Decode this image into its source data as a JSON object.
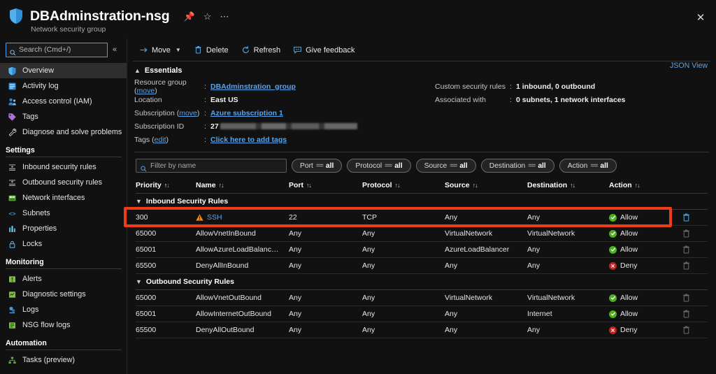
{
  "header": {
    "title": "DBAdminstration-nsg",
    "subtitle": "Network security group",
    "pin_icon": "pin-icon",
    "favorite_icon": "star-icon",
    "more_icon": "ellipsis-icon",
    "close_icon": "close-icon"
  },
  "sidebar": {
    "search": {
      "placeholder": "Search (Cmd+/)",
      "value": "",
      "icon": "search-icon"
    },
    "collapse_icon": "chevron-double-left-icon",
    "items": [
      {
        "label": "Overview",
        "icon": "shield-icon",
        "active": true
      },
      {
        "label": "Activity log",
        "icon": "activity-log-icon",
        "active": false
      },
      {
        "label": "Access control (IAM)",
        "icon": "access-control-icon",
        "active": false
      },
      {
        "label": "Tags",
        "icon": "tag-icon",
        "active": false
      },
      {
        "label": "Diagnose and solve problems",
        "icon": "wrench-icon",
        "active": false
      }
    ],
    "sections": [
      {
        "title": "Settings",
        "items": [
          {
            "label": "Inbound security rules",
            "icon": "inbound-rules-icon"
          },
          {
            "label": "Outbound security rules",
            "icon": "outbound-rules-icon"
          },
          {
            "label": "Network interfaces",
            "icon": "network-interface-icon"
          },
          {
            "label": "Subnets",
            "icon": "subnet-icon"
          },
          {
            "label": "Properties",
            "icon": "properties-icon"
          },
          {
            "label": "Locks",
            "icon": "lock-icon"
          }
        ]
      },
      {
        "title": "Monitoring",
        "items": [
          {
            "label": "Alerts",
            "icon": "alerts-icon"
          },
          {
            "label": "Diagnostic settings",
            "icon": "diagnostic-settings-icon"
          },
          {
            "label": "Logs",
            "icon": "logs-icon"
          },
          {
            "label": "NSG flow logs",
            "icon": "nsg-flow-logs-icon"
          }
        ]
      },
      {
        "title": "Automation",
        "items": [
          {
            "label": "Tasks (preview)",
            "icon": "tasks-icon"
          }
        ]
      }
    ]
  },
  "toolbar": {
    "move_label": "Move",
    "move_icon": "arrow-right-icon",
    "move_caret": "chevron-down-icon",
    "delete_label": "Delete",
    "delete_icon": "trash-icon",
    "refresh_label": "Refresh",
    "refresh_icon": "refresh-icon",
    "feedback_label": "Give feedback",
    "feedback_icon": "feedback-icon"
  },
  "essentials": {
    "title": "Essentials",
    "collapse_icon": "chevron-up-icon",
    "json_view": "JSON View",
    "left": [
      {
        "label": "Resource group",
        "sublink": "move",
        "colon": ":",
        "value": "DBAdminstration_group",
        "value_is_link": true
      },
      {
        "label": "Location",
        "sublink": "",
        "colon": ":",
        "value": "East US",
        "value_is_link": false
      },
      {
        "label": "Subscription",
        "sublink": "move",
        "colon": ":",
        "value": "Azure subscription 1",
        "value_is_link": true
      },
      {
        "label": "Subscription ID",
        "sublink": "",
        "colon": ":",
        "value": "27",
        "value_is_link": false,
        "redacted": true
      },
      {
        "label": "Tags",
        "sublink": "edit",
        "colon": ":",
        "value": "Click here to add tags",
        "value_is_link": true
      }
    ],
    "right": [
      {
        "label": "Custom security rules",
        "colon": ":",
        "value": "1 inbound, 0 outbound"
      },
      {
        "label": "Associated with",
        "colon": ":",
        "value": "0 subnets, 1 network interfaces"
      }
    ]
  },
  "filters": {
    "name_filter": {
      "placeholder": "Filter by name",
      "value": "",
      "icon": "search-icon"
    },
    "pills": [
      {
        "field": "Port",
        "op": "==",
        "value": "all"
      },
      {
        "field": "Protocol",
        "op": "==",
        "value": "all"
      },
      {
        "field": "Source",
        "op": "==",
        "value": "all"
      },
      {
        "field": "Destination",
        "op": "==",
        "value": "all"
      },
      {
        "field": "Action",
        "op": "==",
        "value": "all"
      }
    ]
  },
  "table": {
    "columns": [
      {
        "label": "Priority",
        "sorted": true
      },
      {
        "label": "Name",
        "sorted": false
      },
      {
        "label": "Port",
        "sorted": false
      },
      {
        "label": "Protocol",
        "sorted": false
      },
      {
        "label": "Source",
        "sorted": false
      },
      {
        "label": "Destination",
        "sorted": false
      },
      {
        "label": "Action",
        "sorted": false
      }
    ],
    "groups": [
      {
        "title": "Inbound Security Rules",
        "chevron": "chevron-down-icon",
        "rows": [
          {
            "priority": "300",
            "name": "SSH",
            "port": "22",
            "protocol": "TCP",
            "source": "Any",
            "destination": "Any",
            "action": "Allow",
            "action_kind": "allow",
            "warning": true,
            "name_link": true,
            "highlighted": true,
            "delete_active": true
          },
          {
            "priority": "65000",
            "name": "AllowVnetInBound",
            "port": "Any",
            "protocol": "Any",
            "source": "VirtualNetwork",
            "destination": "VirtualNetwork",
            "action": "Allow",
            "action_kind": "allow",
            "warning": false,
            "name_link": false,
            "highlighted": false,
            "delete_active": false
          },
          {
            "priority": "65001",
            "name": "AllowAzureLoadBalancer…",
            "port": "Any",
            "protocol": "Any",
            "source": "AzureLoadBalancer",
            "destination": "Any",
            "action": "Allow",
            "action_kind": "allow",
            "warning": false,
            "name_link": false,
            "highlighted": false,
            "delete_active": false
          },
          {
            "priority": "65500",
            "name": "DenyAllInBound",
            "port": "Any",
            "protocol": "Any",
            "source": "Any",
            "destination": "Any",
            "action": "Deny",
            "action_kind": "deny",
            "warning": false,
            "name_link": false,
            "highlighted": false,
            "delete_active": false
          }
        ]
      },
      {
        "title": "Outbound Security Rules",
        "chevron": "chevron-down-icon",
        "rows": [
          {
            "priority": "65000",
            "name": "AllowVnetOutBound",
            "port": "Any",
            "protocol": "Any",
            "source": "VirtualNetwork",
            "destination": "VirtualNetwork",
            "action": "Allow",
            "action_kind": "allow",
            "warning": false,
            "name_link": false,
            "highlighted": false,
            "delete_active": false
          },
          {
            "priority": "65001",
            "name": "AllowInternetOutBound",
            "port": "Any",
            "protocol": "Any",
            "source": "Any",
            "destination": "Internet",
            "action": "Allow",
            "action_kind": "allow",
            "warning": false,
            "name_link": false,
            "highlighted": false,
            "delete_active": false
          },
          {
            "priority": "65500",
            "name": "DenyAllOutBound",
            "port": "Any",
            "protocol": "Any",
            "source": "Any",
            "destination": "Any",
            "action": "Deny",
            "action_kind": "deny",
            "warning": false,
            "name_link": false,
            "highlighted": false,
            "delete_active": false
          }
        ]
      }
    ]
  },
  "annotation": {
    "highlight_color": "#ef3b18",
    "target_row": "300"
  },
  "colors": {
    "background": "#111111",
    "link": "#5aa3e8",
    "allow": "#4caf1e",
    "deny": "#d11b1b",
    "warning": "#f08a18"
  }
}
